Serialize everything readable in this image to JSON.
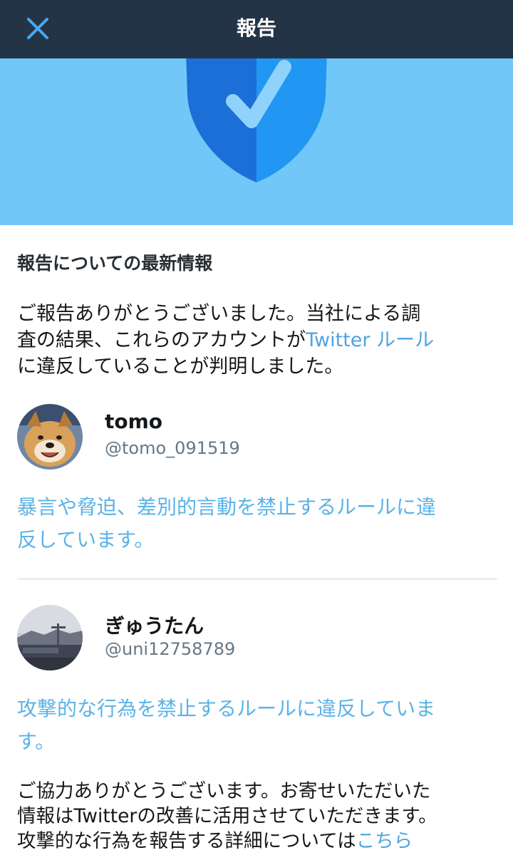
{
  "header": {
    "title": "報告",
    "close_icon": "close-icon",
    "background": "#243447",
    "accent": "#4aa8f0"
  },
  "banner": {
    "icon": "shield-check-icon",
    "background": "#71c8f8"
  },
  "report": {
    "heading": "報告についての最新情報",
    "intro_line1": "ご報告ありがとうございました。当社による調",
    "intro_line2_prefix": "査の結果、これらのアカウントが",
    "intro_rules_link": "Twitter ルール",
    "intro_line3": "に違反していることが判明しました。"
  },
  "accounts": [
    {
      "name": "tomo",
      "handle": "@tomo_091519",
      "avatar": "dog-avatar",
      "violation_line1": "暴言や脅迫、差別的言動を禁止するルールに違",
      "violation_line2": "反しています。"
    },
    {
      "name": "ぎゅうたん",
      "handle": "@uni12758789",
      "avatar": "harbor-avatar",
      "violation_line1": "攻撃的な行為を禁止するルールに違反していま",
      "violation_line2": "す。"
    }
  ],
  "closing": {
    "line1": "ご協力ありがとうございます。お寄せいただいた",
    "line2": "情報はTwitterの改善に活用させていただきます。",
    "line3_prefix": "攻撃的な行為を報告する詳細については",
    "line3_link": "こちら"
  },
  "colors": {
    "link": "#4fa3e0",
    "violation_link": "#5ab3e6",
    "handle": "#657786",
    "divider": "#ccd6dd"
  }
}
